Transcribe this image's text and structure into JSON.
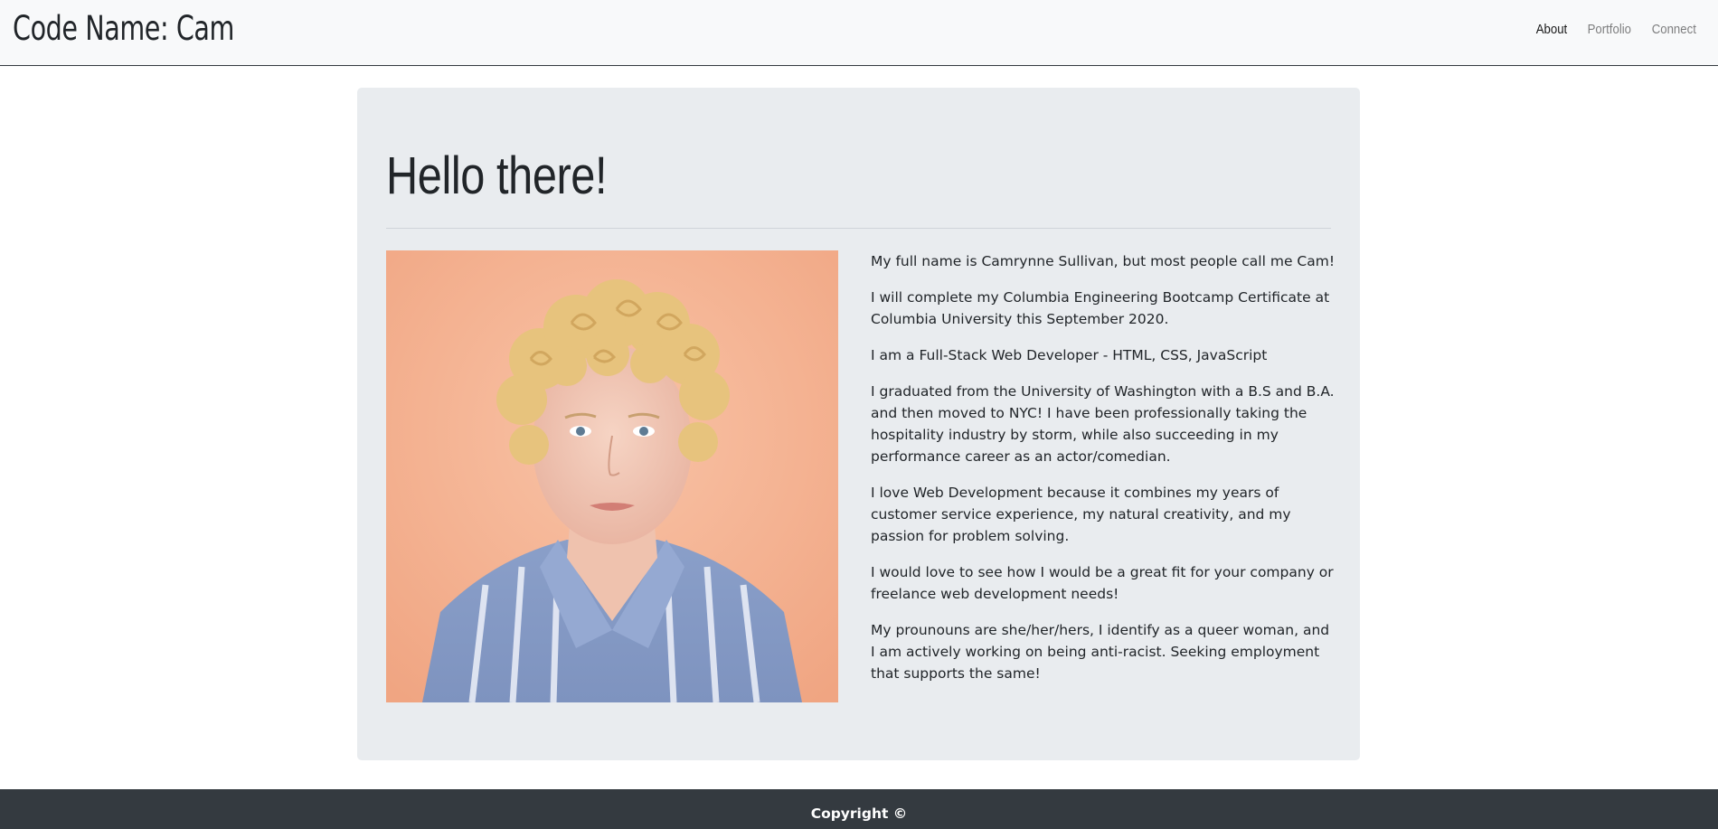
{
  "header": {
    "brand": "Code Name: Cam",
    "nav": [
      {
        "label": "About",
        "active": true
      },
      {
        "label": "Portfolio",
        "active": false
      },
      {
        "label": "Connect",
        "active": false
      }
    ]
  },
  "main": {
    "headline": "Hello there!",
    "bio": [
      "My full name is Camrynne Sullivan, but most people call me Cam!",
      "I will complete my Columbia Engineering Bootcamp Certificate at Columbia University this September 2020.",
      "I am a Full-Stack Web Developer - HTML, CSS, JavaScript",
      "I graduated from the University of Washington with a B.S and B.A. and then moved to NYC! I have been professionally taking the hospitality industry by storm, while also succeeding in my performance career as an actor/comedian.",
      "I love Web Development because it combines my years of customer service experience, my natural creativity, and my passion for problem solving.",
      "I would love to see how I would be a great fit for your company or freelance web development needs!",
      "My prounouns are she/her/hers, I identify as a queer woman, and I am actively working on being anti-racist. Seeking employment that supports the same!"
    ]
  },
  "footer": {
    "text": "Copyright ©"
  },
  "colors": {
    "navbar_bg": "#f8f9fa",
    "jumbotron_bg": "#e9ecef",
    "footer_bg": "#343a40",
    "photo_bg": "#f6b596"
  }
}
